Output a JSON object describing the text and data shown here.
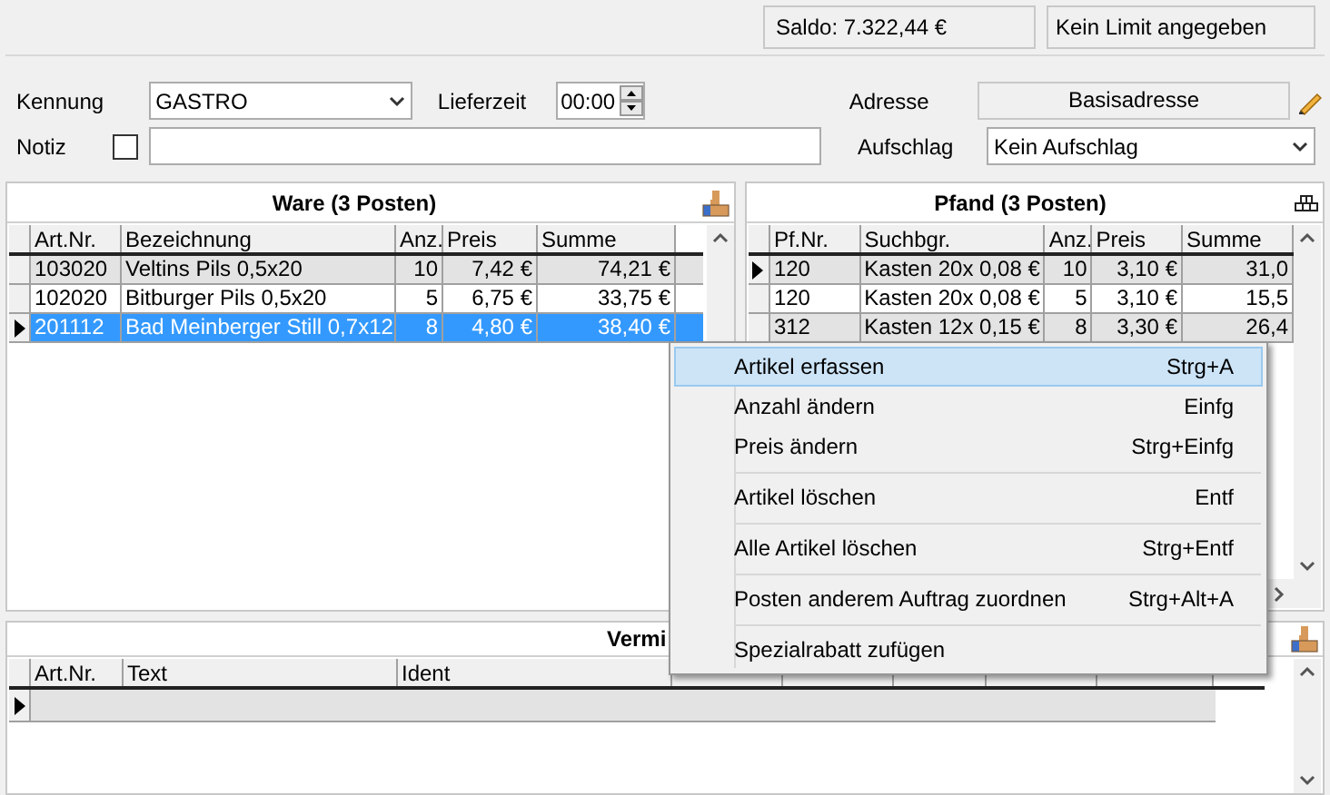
{
  "status": {
    "saldo": "Saldo: 7.322,44 €",
    "limit": "Kein Limit angegeben"
  },
  "form": {
    "kennung": {
      "label": "Kennung",
      "value": "GASTRO"
    },
    "lieferzeit": {
      "label": "Lieferzeit",
      "value": "00:00"
    },
    "adresse": {
      "label": "Adresse",
      "value": "Basisadresse"
    },
    "notiz": {
      "label": "Notiz",
      "checked": false
    },
    "aufschlag": {
      "label": "Aufschlag",
      "value": "Kein Aufschlag"
    }
  },
  "ware": {
    "title": "Ware (3 Posten)",
    "columns": [
      {
        "label": "Art.Nr."
      },
      {
        "label": "Bezeichnung"
      },
      {
        "label": "Anz."
      },
      {
        "label": "Preis"
      },
      {
        "label": "Summe"
      }
    ],
    "rows": [
      {
        "cells": [
          "103020",
          "Veltins Pils 0,5x20",
          "10",
          "7,42 €",
          "74,21 €"
        ],
        "selected": false,
        "current": false
      },
      {
        "cells": [
          "102020",
          "Bitburger Pils 0,5x20",
          "5",
          "6,75 €",
          "33,75 €"
        ],
        "selected": false,
        "current": false
      },
      {
        "cells": [
          "201112",
          "Bad Meinberger Still 0,7x12",
          "8",
          "4,80 €",
          "38,40 €"
        ],
        "selected": true,
        "current": true
      }
    ]
  },
  "pfand": {
    "title": "Pfand (3 Posten)",
    "columns": [
      {
        "label": "Pf.Nr."
      },
      {
        "label": "Suchbgr."
      },
      {
        "label": "Anz."
      },
      {
        "label": "Preis"
      },
      {
        "label": "Summe"
      }
    ],
    "rows": [
      {
        "cells": [
          "120",
          "Kasten 20x 0,08 €",
          "10",
          "3,10 €",
          "31,0"
        ],
        "selected": false,
        "current": true
      },
      {
        "cells": [
          "120",
          "Kasten 20x 0,08 €",
          "5",
          "3,10 €",
          "15,5"
        ],
        "selected": false,
        "current": false
      },
      {
        "cells": [
          "312",
          "Kasten 12x 0,15 €",
          "8",
          "3,30 €",
          "26,4"
        ],
        "selected": false,
        "current": false
      }
    ]
  },
  "vermi": {
    "title": "Vermi",
    "columns": [
      {
        "label": "Art.Nr."
      },
      {
        "label": "Text"
      },
      {
        "label": "Ident"
      }
    ],
    "rows": [
      {
        "current": true
      }
    ]
  },
  "context_menu": {
    "items": [
      {
        "label": "Artikel erfassen",
        "shortcut": "Strg+A",
        "selected": true,
        "separator_before": false
      },
      {
        "label": "Anzahl ändern",
        "shortcut": "Einfg",
        "selected": false,
        "separator_before": false
      },
      {
        "label": "Preis ändern",
        "shortcut": "Strg+Einfg",
        "selected": false,
        "separator_before": false
      },
      {
        "label": "Artikel löschen",
        "shortcut": "Entf",
        "selected": false,
        "separator_before": true
      },
      {
        "label": "Alle Artikel löschen",
        "shortcut": "Strg+Entf",
        "selected": false,
        "separator_before": true
      },
      {
        "label": "Posten anderem Auftrag zuordnen",
        "shortcut": "Strg+Alt+A",
        "selected": false,
        "separator_before": true
      },
      {
        "label": "Spezialrabatt zufügen",
        "selected": false,
        "separator_before": true
      }
    ]
  }
}
